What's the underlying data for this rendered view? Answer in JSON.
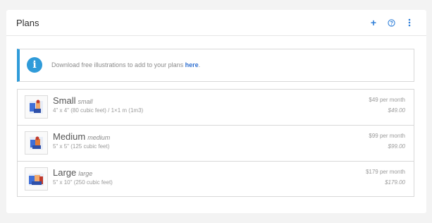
{
  "header": {
    "title": "Plans",
    "add_label": "+",
    "help_icon": "help-circle-icon",
    "more_icon": "vertical-dots-icon"
  },
  "info": {
    "icon": "info-icon",
    "text": "Download free illustrations to add to your plans ",
    "link_text": "here",
    "trailing": "."
  },
  "plans": [
    {
      "name": "Small",
      "slug": "small",
      "dims": "4\" x 4\" (80 cubic feet) / 1×1 m (1m3)",
      "price": "$49 per month",
      "price_sub": "$49.00"
    },
    {
      "name": "Medium",
      "slug": "medium",
      "dims": "5\" x 5\" (125 cubic feet)",
      "price": "$99 per month",
      "price_sub": "$99.00"
    },
    {
      "name": "Large",
      "slug": "large",
      "dims": "5\" x 10\" (250 cubic feet)",
      "price": "$179 per month",
      "price_sub": "$179.00"
    }
  ],
  "colors": {
    "accent": "#2f7fd9",
    "info": "#2f9bd9",
    "link": "#2f6fd0"
  }
}
